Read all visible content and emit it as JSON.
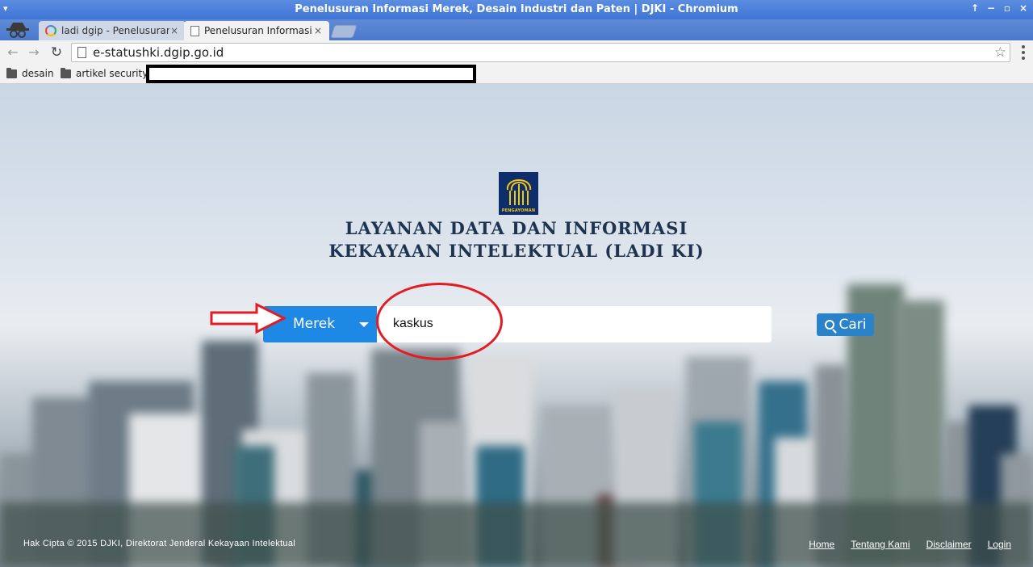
{
  "window": {
    "title": "Penelusuran Informasi Merek, Desain Industri dan Paten | DJKI - Chromium",
    "controls": [
      "↑",
      "−",
      "▫",
      "×"
    ]
  },
  "tabs": [
    {
      "label": "ladi dgip - Penelusuran",
      "icon": "google-icon",
      "close": "×"
    },
    {
      "label": "Penelusuran Informasi",
      "icon": "document-icon",
      "close": "×"
    }
  ],
  "toolbar": {
    "url": "e-statushki.dgip.go.id",
    "back": "←",
    "forward": "→",
    "reload": "↻",
    "star": "☆"
  },
  "bookmarks": [
    {
      "label": "desain",
      "icon": "folder-icon"
    },
    {
      "label": "artikel security",
      "icon": "folder-icon"
    }
  ],
  "page": {
    "logo_label": "PENGAYOMAN",
    "heading_line1": "LAYANAN DATA DAN INFORMASI",
    "heading_line2": "KEKAYAAN INTELEKTUAL (LADI KI)",
    "search": {
      "category": "Merek",
      "query": "kaskus",
      "button_label": "Cari"
    },
    "footer": {
      "copyright": "Hak Cipta © 2015 DJKI, Direktorat Jenderal Kekayaan Intelektual",
      "links": [
        "Home",
        "Tentang Kami",
        "Disclaimer",
        "Login"
      ]
    }
  },
  "colors": {
    "title_bar": "#4a7fdb",
    "category_button": "#1e88e5",
    "search_button": "#2a83c9",
    "annotation": "#e41b23",
    "heading": "#1d3350",
    "logo_bg": "#0d2d6b",
    "logo_gold": "#f2c514"
  }
}
